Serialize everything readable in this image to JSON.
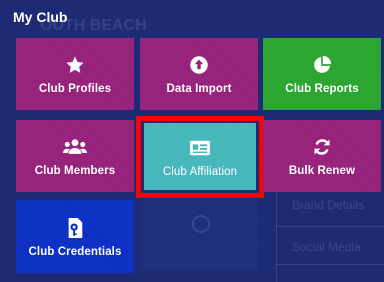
{
  "background": {
    "page_title_ghost": "OUTH BEACH",
    "ghost_items": [
      "Brand Details",
      "Social Media"
    ]
  },
  "menu": {
    "title": "My Club",
    "tiles": [
      {
        "label": "Club Profiles",
        "icon": "star-icon",
        "color": "#96217a"
      },
      {
        "label": "Data Import",
        "icon": "upload-circle-icon",
        "color": "#96217a"
      },
      {
        "label": "Club Reports",
        "icon": "pie-chart-icon",
        "color": "#2aa52f"
      },
      {
        "label": "Club Members",
        "icon": "users-icon",
        "color": "#96217a"
      },
      {
        "label": "Club Affiliation",
        "icon": "id-card-icon",
        "color": "#46b7bb",
        "highlighted": true
      },
      {
        "label": "Bulk Renew",
        "icon": "sync-icon",
        "color": "#96217a"
      },
      {
        "label": "Club Credentials",
        "icon": "key-document-icon",
        "color": "#0b2fc2"
      }
    ]
  },
  "colors": {
    "background": "#1c2b74",
    "highlight_border": "#ff0000"
  }
}
